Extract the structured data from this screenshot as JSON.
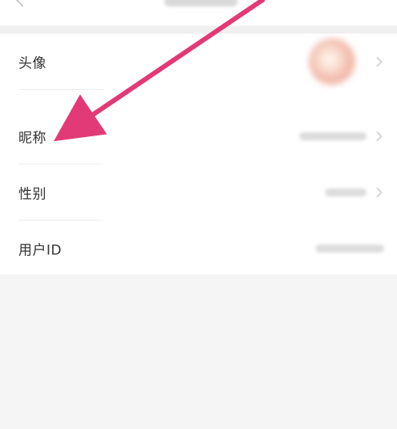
{
  "rows": [
    {
      "label": "头像"
    },
    {
      "label": "昵称"
    },
    {
      "label": "性别"
    },
    {
      "label": "用户ID"
    }
  ],
  "colors": {
    "annotation_arrow": "#e23a76",
    "background": "#f5f5f5",
    "card": "#ffffff",
    "label_text": "#333333"
  },
  "icons": {
    "back": "chevron-left-icon",
    "row_chevron": "chevron-right-icon",
    "annotation": "arrow-icon"
  }
}
